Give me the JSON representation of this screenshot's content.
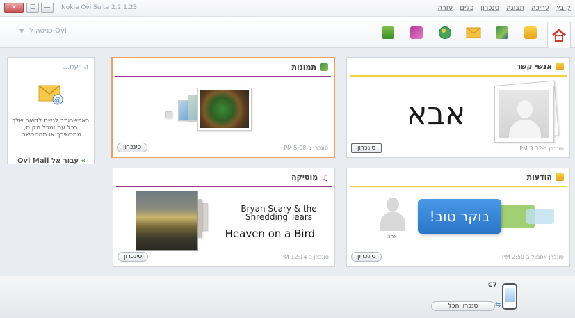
{
  "titlebar": {
    "app_title": "Nokia Ovi Suite 2.2.1.23",
    "close_label": "✕",
    "max_label": "☐",
    "min_label": "—",
    "menu": [
      "קובץ",
      "עריכה",
      "תצוגה",
      "סנכרון",
      "כלים",
      "עזרה"
    ]
  },
  "toolbar": {
    "goto_label": "כניסה ל-Ovi",
    "icons": [
      "home-icon",
      "contacts-icon",
      "photos-icon",
      "messages-icon",
      "maps-icon",
      "music-icon",
      "store-icon"
    ]
  },
  "side_panel": {
    "heading": "...הידעת",
    "text": "באפשרותך לגשת לדואר שלך בכל עת ומכל מקום, ממכשירך או מהמחשב.",
    "link": "עבור אל Ovi Mail"
  },
  "tiles": {
    "contacts": {
      "title": "אנשי קשר",
      "big_name": "אבא",
      "sync_status": "סונכרן ב-3:32 PM",
      "sync_button": "סינכרון",
      "accent": "#f2d43a"
    },
    "photos": {
      "title": "תמונות",
      "sync_status": "סונכרן ב-5:08 PM",
      "sync_button": "סינכרון",
      "accent": "#a2328c"
    },
    "messages": {
      "title": "הודעות",
      "bubble_text": "בוקר טוב!",
      "sender_label": "אתה",
      "sync_status": "סונכרן אתמול ב-2:59 PM",
      "sync_button": "סינכרון",
      "accent": "#f2d43a"
    },
    "music": {
      "title": "מוסיקה",
      "artist": "Bryan Scary & the Shredding Tears",
      "album": "Heaven on a Bird",
      "sync_status": "סונכרן ב-12:14 PM",
      "sync_button": "סינכרון",
      "accent": "#a2328c"
    }
  },
  "bottom": {
    "device_name": "C7",
    "sync_all_button": "סנכרון הכל"
  }
}
